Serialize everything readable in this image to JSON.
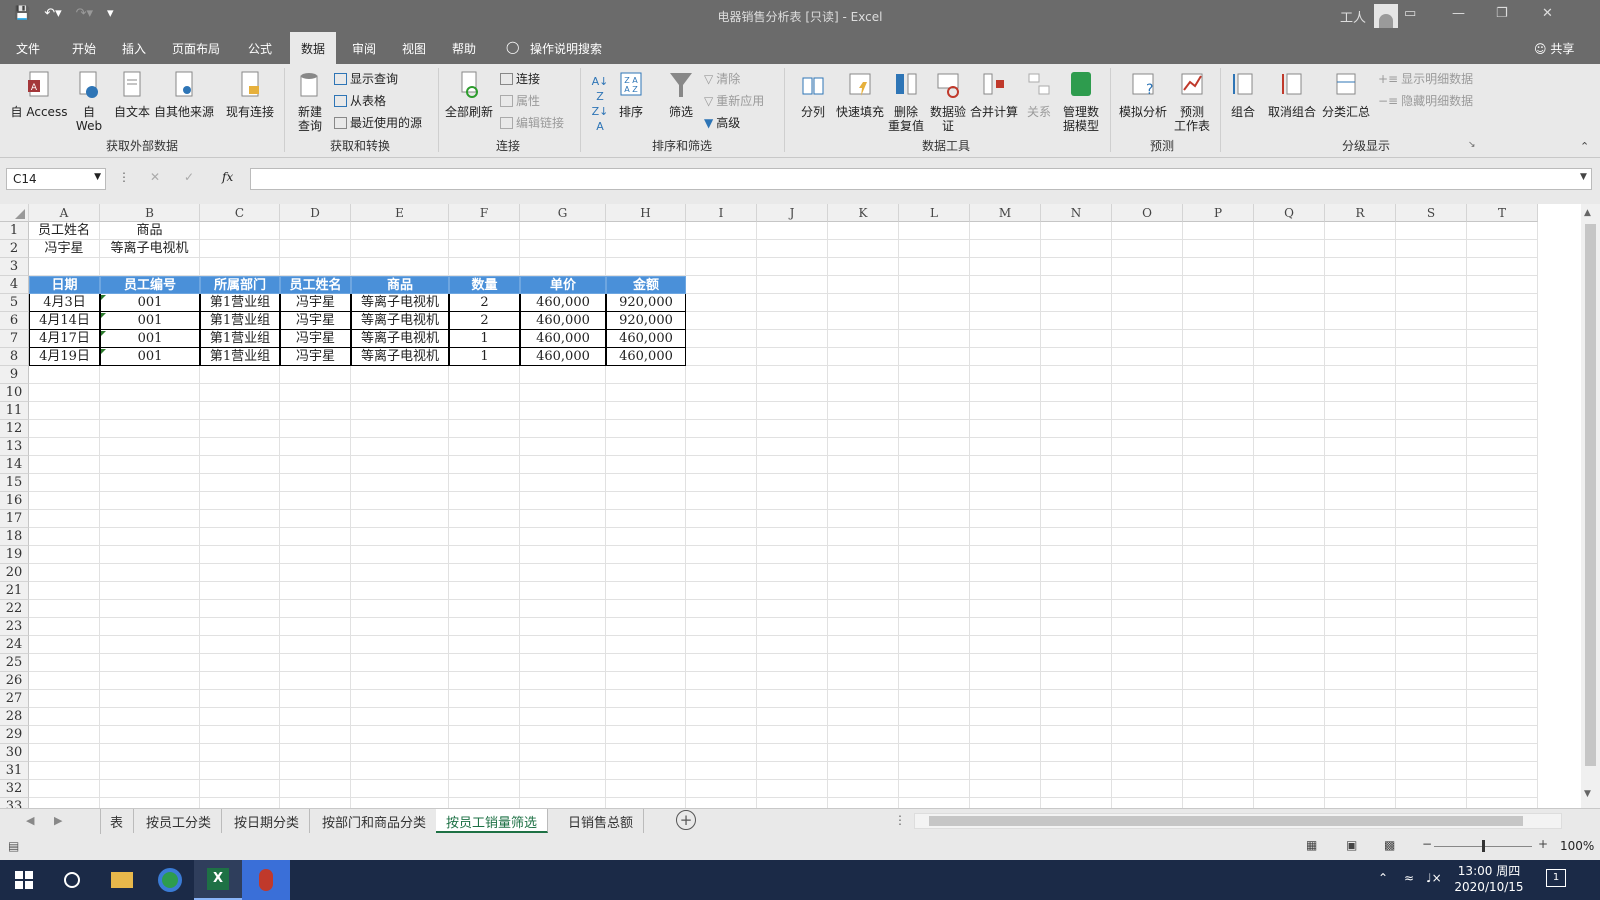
{
  "window": {
    "title": "电器销售分析表  [只读]  -  Excel",
    "user": "工人"
  },
  "menu_tabs": [
    "文件",
    "开始",
    "插入",
    "页面布局",
    "公式",
    "数据",
    "审阅",
    "视图",
    "帮助"
  ],
  "active_tab": "数据",
  "tell_me": "操作说明搜索",
  "share": "共享",
  "ribbon": {
    "access": "自 Access",
    "web": "自\nWeb",
    "text": "自文本",
    "other": "自其他来源",
    "existing": "现有连接",
    "new_query": "新建\n查询",
    "show_query": "显示查询",
    "from_table": "从表格",
    "recent": "最近使用的源",
    "refresh_all": "全部刷新",
    "connections": "连接",
    "properties": "属性",
    "edit_links": "编辑链接",
    "sort": "排序",
    "filter": "筛选",
    "clear": "清除",
    "reapply": "重新应用",
    "advanced": "高级",
    "split": "分列",
    "flash_fill": "快速填充",
    "remove_dup": "删除\n重复值",
    "validation": "数据验\n证",
    "consolidate": "合并计算",
    "relations": "关系",
    "data_model": "管理数\n据模型",
    "whatif": "模拟分析",
    "forecast": "预测\n工作表",
    "group": "组合",
    "ungroup": "取消组合",
    "subtotal": "分类汇总",
    "show_detail": "显示明细数据",
    "hide_detail": "隐藏明细数据",
    "groups": [
      "获取外部数据",
      "获取和转换",
      "连接",
      "排序和筛选",
      "数据工具",
      "预测",
      "分级显示"
    ]
  },
  "formula_bar": {
    "name_box": "C14",
    "fx": "fx",
    "content": ""
  },
  "columns": [
    "A",
    "B",
    "C",
    "D",
    "E",
    "F",
    "G",
    "H",
    "I",
    "J",
    "K",
    "L",
    "M",
    "N",
    "O",
    "P",
    "Q",
    "R",
    "S",
    "T"
  ],
  "criteria": {
    "headers": [
      "员工姓名",
      "商品"
    ],
    "values": [
      "冯宇星",
      "等离子电视机"
    ]
  },
  "table": {
    "headers": [
      "日期",
      "员工编号",
      "所属部门",
      "员工姓名",
      "商品",
      "数量",
      "单价",
      "金额"
    ],
    "rows": [
      [
        "4月3日",
        "001",
        "第1营业组",
        "冯宇星",
        "等离子电视机",
        "2",
        "460,000",
        "920,000"
      ],
      [
        "4月14日",
        "001",
        "第1营业组",
        "冯宇星",
        "等离子电视机",
        "2",
        "460,000",
        "920,000"
      ],
      [
        "4月17日",
        "001",
        "第1营业组",
        "冯宇星",
        "等离子电视机",
        "1",
        "460,000",
        "460,000"
      ],
      [
        "4月19日",
        "001",
        "第1营业组",
        "冯宇星",
        "等离子电视机",
        "1",
        "460,000",
        "460,000"
      ]
    ]
  },
  "sheet_tabs": [
    "表",
    "按员工分类",
    "按日期分类",
    "按部门和商品分类",
    "按员工销量筛选",
    "日销售总额"
  ],
  "active_sheet": "按员工销量筛选",
  "status": {
    "zoom": "100%"
  },
  "taskbar": {
    "time": "13:00 周四",
    "date": "2020/10/15",
    "notifications": "1"
  },
  "colors": {
    "header_fill": "#4a90d9",
    "excel_green": "#1e7145",
    "titlebar": "#6b6b6b"
  }
}
